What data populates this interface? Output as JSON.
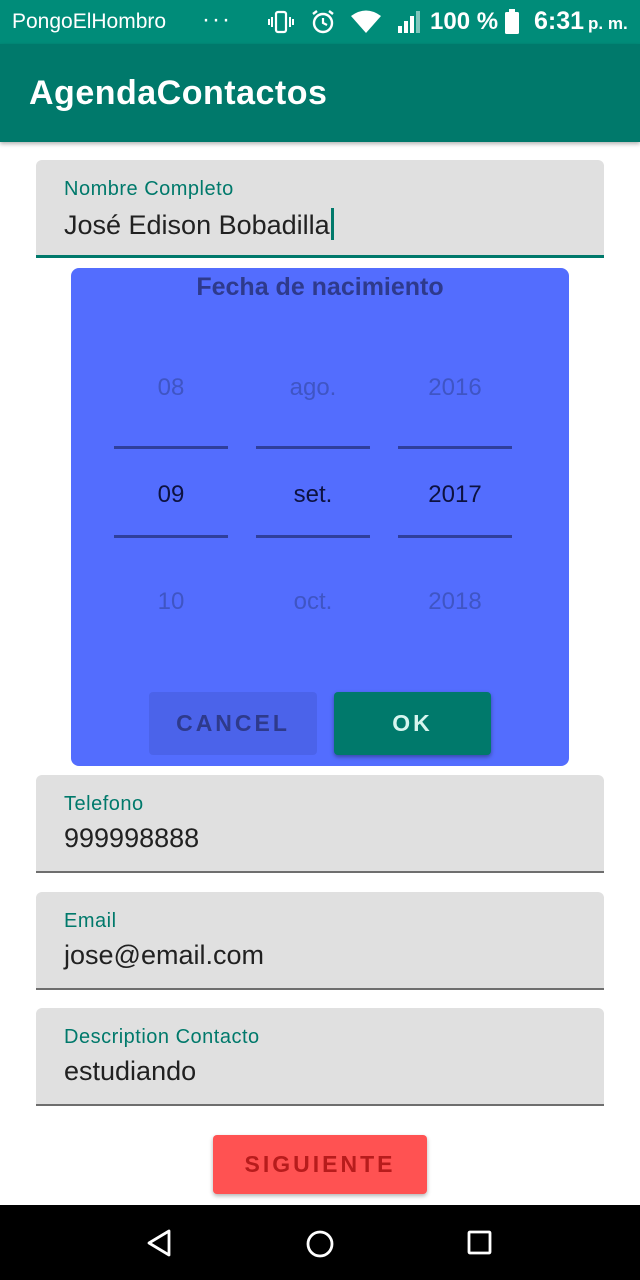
{
  "status_bar": {
    "carrier": "PongoElHombro",
    "overflow": "···",
    "battery_percent": "100 %",
    "time": "6:31",
    "ampm": "p. m.",
    "icons": [
      "vibrate-icon",
      "alarm-icon",
      "wifi-icon",
      "signal-icon",
      "battery-icon"
    ]
  },
  "app_bar": {
    "title": "AgendaContactos"
  },
  "form": {
    "nombre": {
      "label": "Nombre Completo",
      "value": "José Edison Bobadilla"
    },
    "telefono": {
      "label": "Telefono",
      "value": "999998888"
    },
    "email": {
      "label": "Email",
      "value": "jose@email.com"
    },
    "descripcion": {
      "label": "Description Contacto",
      "value": "estudiando"
    }
  },
  "date_picker": {
    "title": "Fecha de nacimiento",
    "day": {
      "prev": "08",
      "selected": "09",
      "next": "10"
    },
    "month": {
      "prev": "ago.",
      "selected": "set.",
      "next": "oct."
    },
    "year": {
      "prev": "2016",
      "selected": "2017",
      "next": "2018"
    },
    "cancel_label": "CANCEL",
    "ok_label": "OK"
  },
  "siguiente_label": "SIGUIENTE",
  "nav_bar": {
    "icons": [
      "back-icon",
      "home-icon",
      "recents-icon"
    ]
  },
  "colors": {
    "status_bar": "#008c79",
    "app_bar": "#00796b",
    "dialog": "#536dfe",
    "accent": "#00796b",
    "siguiente_button": "#ff5252"
  }
}
